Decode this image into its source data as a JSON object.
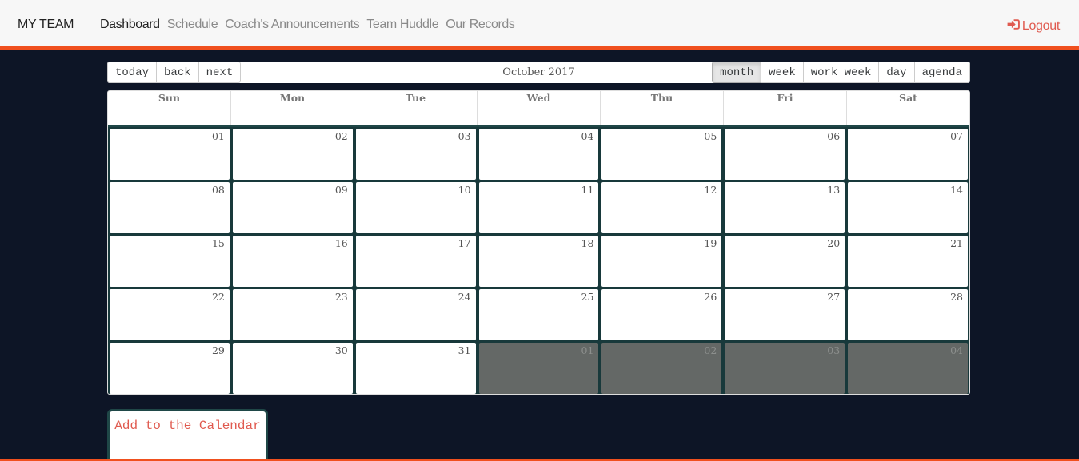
{
  "navbar": {
    "brand": "MY TEAM",
    "links": [
      "Dashboard",
      "Schedule",
      "Coach's Announcements",
      "Team Huddle",
      "Our Records"
    ],
    "active_link": "Dashboard",
    "logout_label": "Logout",
    "logout_icon": "sign-in-icon",
    "accent_color": "#f0501e",
    "logout_color": "#e05a4f"
  },
  "toolbar": {
    "nav_buttons": [
      "today",
      "back",
      "next"
    ],
    "label": "October 2017",
    "view_buttons": [
      "month",
      "week",
      "work week",
      "day",
      "agenda"
    ],
    "active_view": "month"
  },
  "calendar": {
    "weekday_headers": [
      "Sun",
      "Mon",
      "Tue",
      "Wed",
      "Thu",
      "Fri",
      "Sat"
    ],
    "weeks": [
      [
        {
          "date": "01",
          "off": false
        },
        {
          "date": "02",
          "off": false
        },
        {
          "date": "03",
          "off": false
        },
        {
          "date": "04",
          "off": false
        },
        {
          "date": "05",
          "off": false
        },
        {
          "date": "06",
          "off": false
        },
        {
          "date": "07",
          "off": false
        }
      ],
      [
        {
          "date": "08",
          "off": false
        },
        {
          "date": "09",
          "off": false
        },
        {
          "date": "10",
          "off": false
        },
        {
          "date": "11",
          "off": false
        },
        {
          "date": "12",
          "off": false
        },
        {
          "date": "13",
          "off": false
        },
        {
          "date": "14",
          "off": false
        }
      ],
      [
        {
          "date": "15",
          "off": false
        },
        {
          "date": "16",
          "off": false
        },
        {
          "date": "17",
          "off": false
        },
        {
          "date": "18",
          "off": false
        },
        {
          "date": "19",
          "off": false
        },
        {
          "date": "20",
          "off": false
        },
        {
          "date": "21",
          "off": false
        }
      ],
      [
        {
          "date": "22",
          "off": false
        },
        {
          "date": "23",
          "off": false
        },
        {
          "date": "24",
          "off": false
        },
        {
          "date": "25",
          "off": false
        },
        {
          "date": "26",
          "off": false
        },
        {
          "date": "27",
          "off": false
        },
        {
          "date": "28",
          "off": false
        }
      ],
      [
        {
          "date": "29",
          "off": false
        },
        {
          "date": "30",
          "off": false
        },
        {
          "date": "31",
          "off": false
        },
        {
          "date": "01",
          "off": true
        },
        {
          "date": "02",
          "off": true
        },
        {
          "date": "03",
          "off": true
        },
        {
          "date": "04",
          "off": true
        }
      ]
    ],
    "off_range_color": "#646866",
    "grid_color": "#18393b"
  },
  "add_button": {
    "label": "Add to the Calendar"
  },
  "page": {
    "background_color": "#0d1526"
  }
}
